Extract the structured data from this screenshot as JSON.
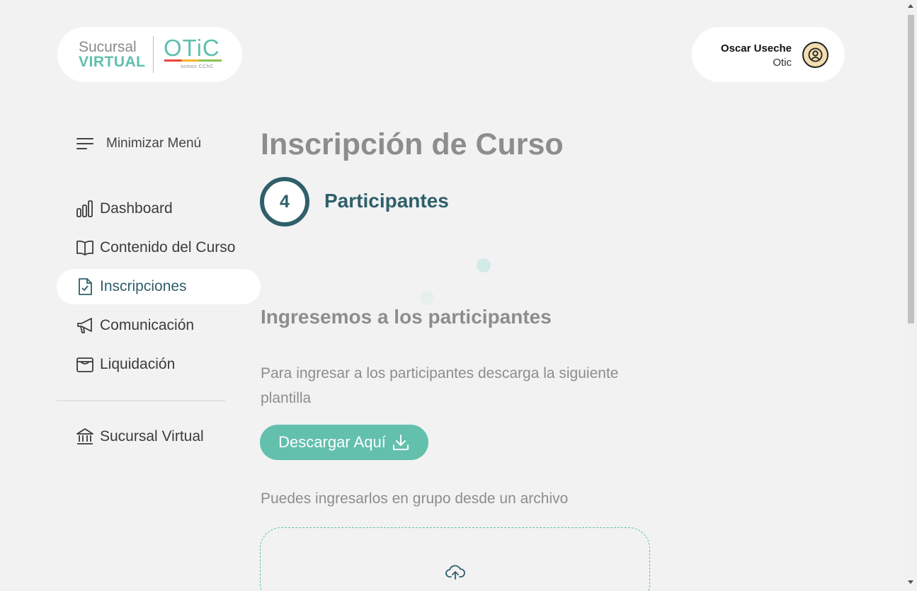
{
  "brand": {
    "line1": "Sucursal",
    "line2": "VIRTUAL",
    "otic": "OTiC",
    "tagline": "somos CChC"
  },
  "user": {
    "name": "Oscar Useche",
    "org": "Otic",
    "avatar_icon": "user-circle-icon"
  },
  "sidebar": {
    "toggle_label": "Minimizar Menú",
    "items": [
      {
        "label": "Dashboard",
        "icon": "bar-chart-icon"
      },
      {
        "label": "Contenido del Curso",
        "icon": "book-icon"
      },
      {
        "label": "Inscripciones",
        "icon": "file-check-icon",
        "active": true
      },
      {
        "label": "Comunicación",
        "icon": "megaphone-icon"
      },
      {
        "label": "Liquidación",
        "icon": "wallet-icon"
      }
    ],
    "footer_item": {
      "label": "Sucursal Virtual",
      "icon": "bank-icon"
    }
  },
  "main": {
    "title": "Inscripción de Curso",
    "step": {
      "number": "4",
      "label": "Participantes"
    },
    "section_title": "Ingresemos a los participantes",
    "description": "Para ingresar a los participantes descarga la siguiente plantilla",
    "download_button": "Descargar Aquí",
    "group_text": "Puedes ingresarlos en grupo desde un archivo"
  },
  "colors": {
    "accent": "#62c0ad",
    "primary_dark": "#2f5f6a",
    "muted_text": "#8d8d8d",
    "background": "#f2f2f2"
  }
}
